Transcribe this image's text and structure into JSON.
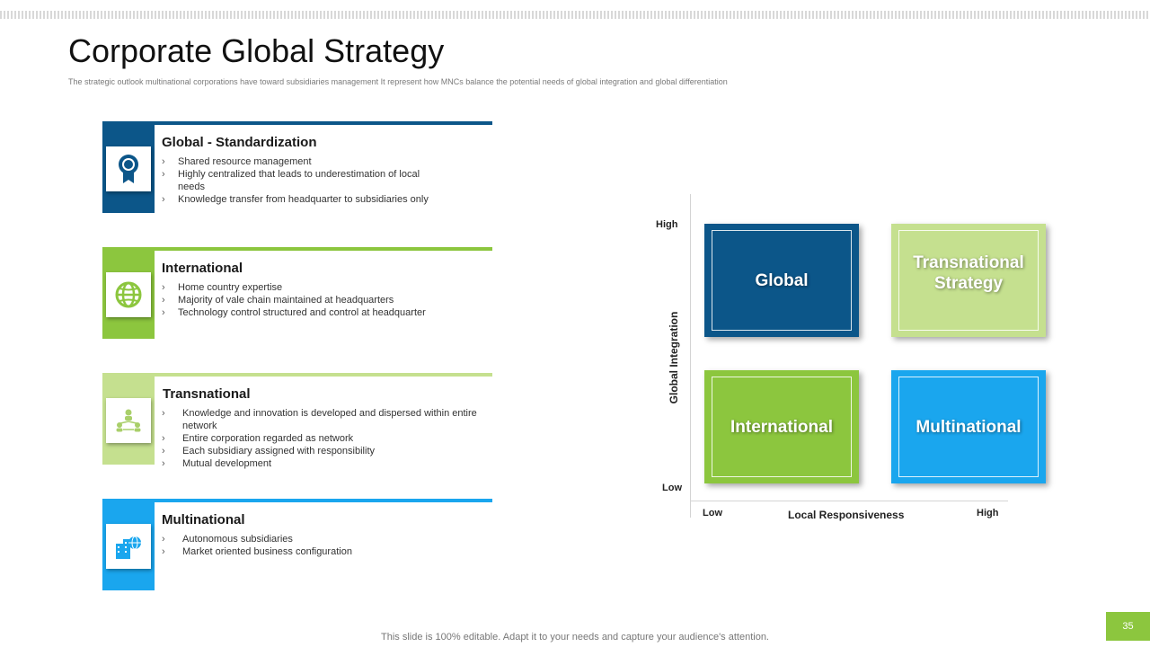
{
  "slide": {
    "title": "Corporate Global Strategy",
    "subtitle": "The strategic outlook multinational corporations have toward subsidiaries management It represent how MNCs balance the potential needs of global integration and global differentiation",
    "footer_note": "This slide is 100% editable. Adapt it to your needs and capture your audience's attention.",
    "page_number": "35"
  },
  "colors": {
    "dark_blue": "#0c5689",
    "green": "#8cc63e",
    "light_green": "#c5e08f",
    "sky_blue": "#1aa6ee"
  },
  "cards": [
    {
      "title": "Global - Standardization",
      "icon": "award-ribbon-icon",
      "color": "#0c5689",
      "bullets": [
        "Shared resource management",
        "Highly centralized that leads to underestimation of local needs",
        "Knowledge transfer from headquarter to subsidiaries only"
      ]
    },
    {
      "title": "International",
      "icon": "globe-icon",
      "color": "#8cc63e",
      "bullets": [
        "Home country expertise",
        "Majority of vale chain maintained at headquarters",
        "Technology control structured and control at headquarter"
      ]
    },
    {
      "title": "Transnational",
      "icon": "network-people-icon",
      "color": "#c5e08f",
      "bullets": [
        "Knowledge and innovation is developed and dispersed within entire network",
        "Entire corporation regarded as network",
        "Each subsidiary assigned with responsibility",
        "Mutual development"
      ]
    },
    {
      "title": "Multinational",
      "icon": "buildings-globe-icon",
      "color": "#1aa6ee",
      "bullets": [
        "Autonomous subsidiaries",
        "Market oriented business configuration"
      ]
    }
  ],
  "matrix": {
    "y_axis_title": "Global Integration",
    "x_axis_title": "Local Responsiveness",
    "y_high": "High",
    "y_low": "Low",
    "x_low": "Low",
    "x_high": "High",
    "quadrants": {
      "top_left": "Global",
      "top_right": "Transnational Strategy",
      "bottom_left": "International",
      "bottom_right": "Multinational"
    }
  }
}
